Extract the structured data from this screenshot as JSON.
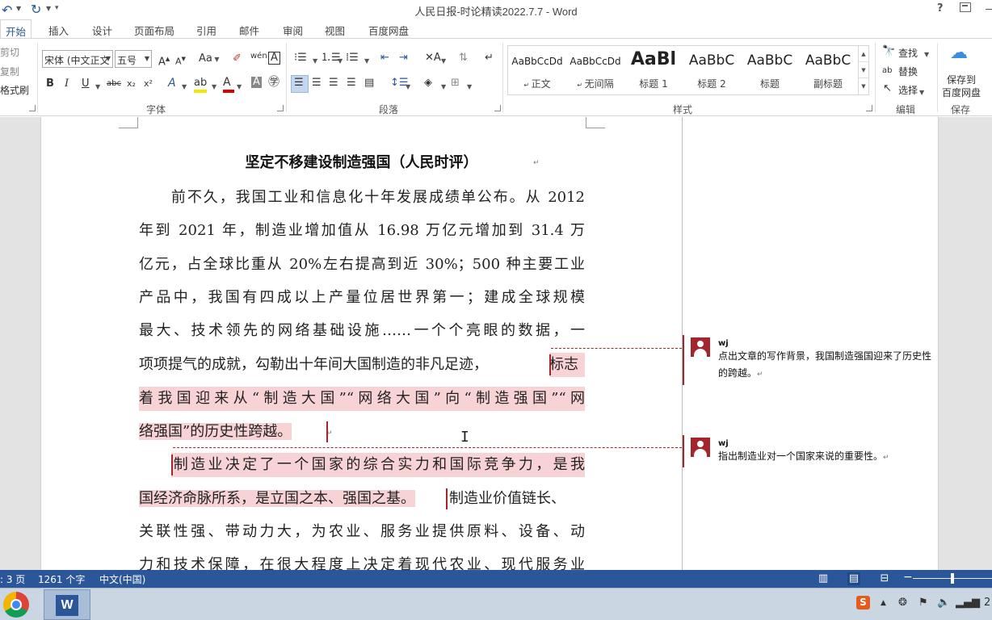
{
  "window": {
    "title": "人民日报-时论精读2022.7.7 - Word",
    "help": "?"
  },
  "quick_access": {
    "undo_icon": "undo-icon",
    "redo_icon": "redo-icon"
  },
  "tabs": [
    "开始",
    "插入",
    "设计",
    "页面布局",
    "引用",
    "邮件",
    "审阅",
    "视图",
    "百度网盘"
  ],
  "clipboard": {
    "cut": "剪切",
    "copy": "复制",
    "format_painter": "格式刷"
  },
  "font": {
    "name": "宋体 (中文正文",
    "size": "五号",
    "label": "字体",
    "grow": "A",
    "shrink": "A",
    "case": "Aa",
    "bold": "B",
    "italic": "I",
    "underline": "U",
    "strike": "abc",
    "subscript": "x₂",
    "superscript": "x²",
    "color_a": "A",
    "pinyin": "wén",
    "border_char": "A"
  },
  "paragraph": {
    "label": "段落"
  },
  "styles": {
    "label": "样式",
    "items": [
      {
        "sample": "AaBbCcDd",
        "name": "正文"
      },
      {
        "sample": "AaBbCcDd",
        "name": "无间隔"
      },
      {
        "sample": "AaBl",
        "name": "标题 1"
      },
      {
        "sample": "AaBbC",
        "name": "标题 2"
      },
      {
        "sample": "AaBbC",
        "name": "标题"
      },
      {
        "sample": "AaBbC",
        "name": "副标题"
      }
    ]
  },
  "editing": {
    "label": "编辑",
    "find": "查找",
    "replace": "替换",
    "select": "选择"
  },
  "save": {
    "label": "保存",
    "button": "保存到\n百度网盘",
    "line1": "保存到",
    "line2": "百度网盘"
  },
  "document": {
    "title": "坚定不移建设制造强国（人民时评）",
    "lines": [
      "　　前不久，我国工业和信息化十年发展成绩单公布。从 2012",
      "年到 2021 年，制造业增加值从 16.98 万亿元增加到 31.4 万",
      "亿元，占全球比重从 20%左右提高到近 30%；500 种主要工业",
      "产品中，我国有四成以上产量位居世界第一；建成全球规模",
      "最大、技术领先的网络基础设施……一个个亮眼的数据，一",
      "项项提气的成就，勾勒出十年间大国制造的非凡足迹，",
      "着我国迎来从“制造大国”“网络大国”向“制造强国”“网",
      "络强国”的历史性跨越。",
      "　　制造业决定了一个国家的综合实力和国际竞争力，是我",
      "国经济命脉所系，是立国之本、强国之基。",
      "关联性强、带动力大，为农业、服务业提供原料、设备、动",
      "力和技术保障，在很大程度上决定着现代农业、现代服务业"
    ],
    "hl_line6_tail": "标志",
    "line10_tail": "制造业价值链长、"
  },
  "comments": [
    {
      "author": "wj",
      "text": "点出文章的写作背景，我国制造强国迎来了历史性的跨越。"
    },
    {
      "author": "wj",
      "text": "指出制造业对一个国家来说的重要性。"
    }
  ],
  "status": {
    "page": ": 3 页",
    "words": "1261 个字",
    "language": "中文(中国)"
  },
  "taskbar": {
    "word_letter": "W",
    "sogou": "S",
    "clock": "2"
  },
  "colors": {
    "accent": "#2b579a",
    "comment": "#a4262c",
    "highlight": "#f8d3d6"
  }
}
